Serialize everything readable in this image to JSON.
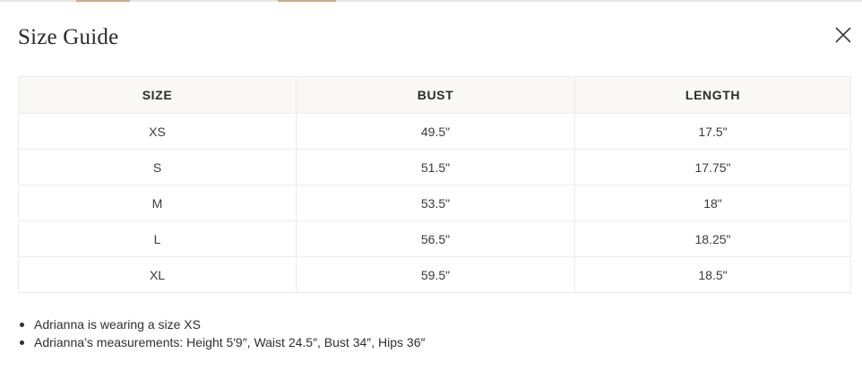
{
  "modal": {
    "title": "Size Guide",
    "close_icon": "close-icon"
  },
  "table": {
    "headers": [
      "SIZE",
      "BUST",
      "LENGTH"
    ],
    "rows": [
      [
        "XS",
        "49.5\"",
        "17.5\""
      ],
      [
        "S",
        "51.5\"",
        "17.75\""
      ],
      [
        "M",
        "53.5\"",
        "18\""
      ],
      [
        "L",
        "56.5\"",
        "18.25\""
      ],
      [
        "XL",
        "59.5\"",
        "18.5\""
      ]
    ]
  },
  "notes": [
    "Adrianna is wearing a size XS",
    "Adrianna’s measurements: Height 5′9″, Waist 24.5″, Bust 34″, Hips 36″"
  ],
  "colors": {
    "header_bg": "#faf8f4",
    "border": "#ececec",
    "text": "#2b2b2b"
  }
}
